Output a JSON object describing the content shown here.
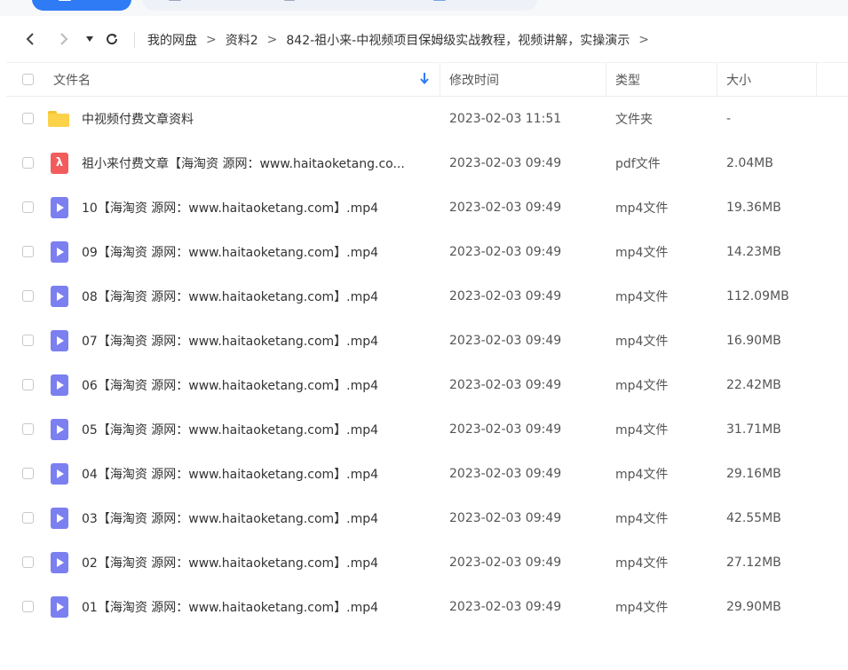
{
  "nav": {
    "back_icon": "chevron-left-icon",
    "forward_icon": "chevron-right-icon",
    "dropdown_icon": "caret-down-icon",
    "refresh_icon": "refresh-icon",
    "breadcrumb": [
      "我的网盘",
      "资料2",
      "842-祖小来-中视频项目保姆级实战教程，视频讲解，实操演示"
    ],
    "separator": ">"
  },
  "table": {
    "headers": {
      "name": "文件名",
      "modified": "修改时间",
      "type": "类型",
      "size": "大小"
    },
    "sort_icon": "arrow-down-icon",
    "rows": [
      {
        "icon": "folder",
        "name": "中视频付费文章资料",
        "modified": "2023-02-03 11:51",
        "type": "文件夹",
        "size": "-"
      },
      {
        "icon": "pdf",
        "name": "祖小来付费文章【海淘资 源网：www.haitaoketang.co...",
        "modified": "2023-02-03 09:49",
        "type": "pdf文件",
        "size": "2.04MB"
      },
      {
        "icon": "video",
        "name": "10【海淘资 源网：www.haitaoketang.com】.mp4",
        "modified": "2023-02-03 09:49",
        "type": "mp4文件",
        "size": "19.36MB"
      },
      {
        "icon": "video",
        "name": "09【海淘资 源网：www.haitaoketang.com】.mp4",
        "modified": "2023-02-03 09:49",
        "type": "mp4文件",
        "size": "14.23MB"
      },
      {
        "icon": "video",
        "name": "08【海淘资 源网：www.haitaoketang.com】.mp4",
        "modified": "2023-02-03 09:49",
        "type": "mp4文件",
        "size": "112.09MB"
      },
      {
        "icon": "video",
        "name": "07【海淘资 源网：www.haitaoketang.com】.mp4",
        "modified": "2023-02-03 09:49",
        "type": "mp4文件",
        "size": "16.90MB"
      },
      {
        "icon": "video",
        "name": "06【海淘资 源网：www.haitaoketang.com】.mp4",
        "modified": "2023-02-03 09:49",
        "type": "mp4文件",
        "size": "22.42MB"
      },
      {
        "icon": "video",
        "name": "05【海淘资 源网：www.haitaoketang.com】.mp4",
        "modified": "2023-02-03 09:49",
        "type": "mp4文件",
        "size": "31.71MB"
      },
      {
        "icon": "video",
        "name": "04【海淘资 源网：www.haitaoketang.com】.mp4",
        "modified": "2023-02-03 09:49",
        "type": "mp4文件",
        "size": "29.16MB"
      },
      {
        "icon": "video",
        "name": "03【海淘资 源网：www.haitaoketang.com】.mp4",
        "modified": "2023-02-03 09:49",
        "type": "mp4文件",
        "size": "42.55MB"
      },
      {
        "icon": "video",
        "name": "02【海淘资 源网：www.haitaoketang.com】.mp4",
        "modified": "2023-02-03 09:49",
        "type": "mp4文件",
        "size": "27.12MB"
      },
      {
        "icon": "video",
        "name": "01【海淘资 源网：www.haitaoketang.com】.mp4",
        "modified": "2023-02-03 09:49",
        "type": "mp4文件",
        "size": "29.90MB"
      }
    ]
  },
  "colors": {
    "accent": "#2f7bf5",
    "folder": "#fbd24a",
    "video": "#7b7ff0",
    "pdf": "#f25c5c"
  }
}
